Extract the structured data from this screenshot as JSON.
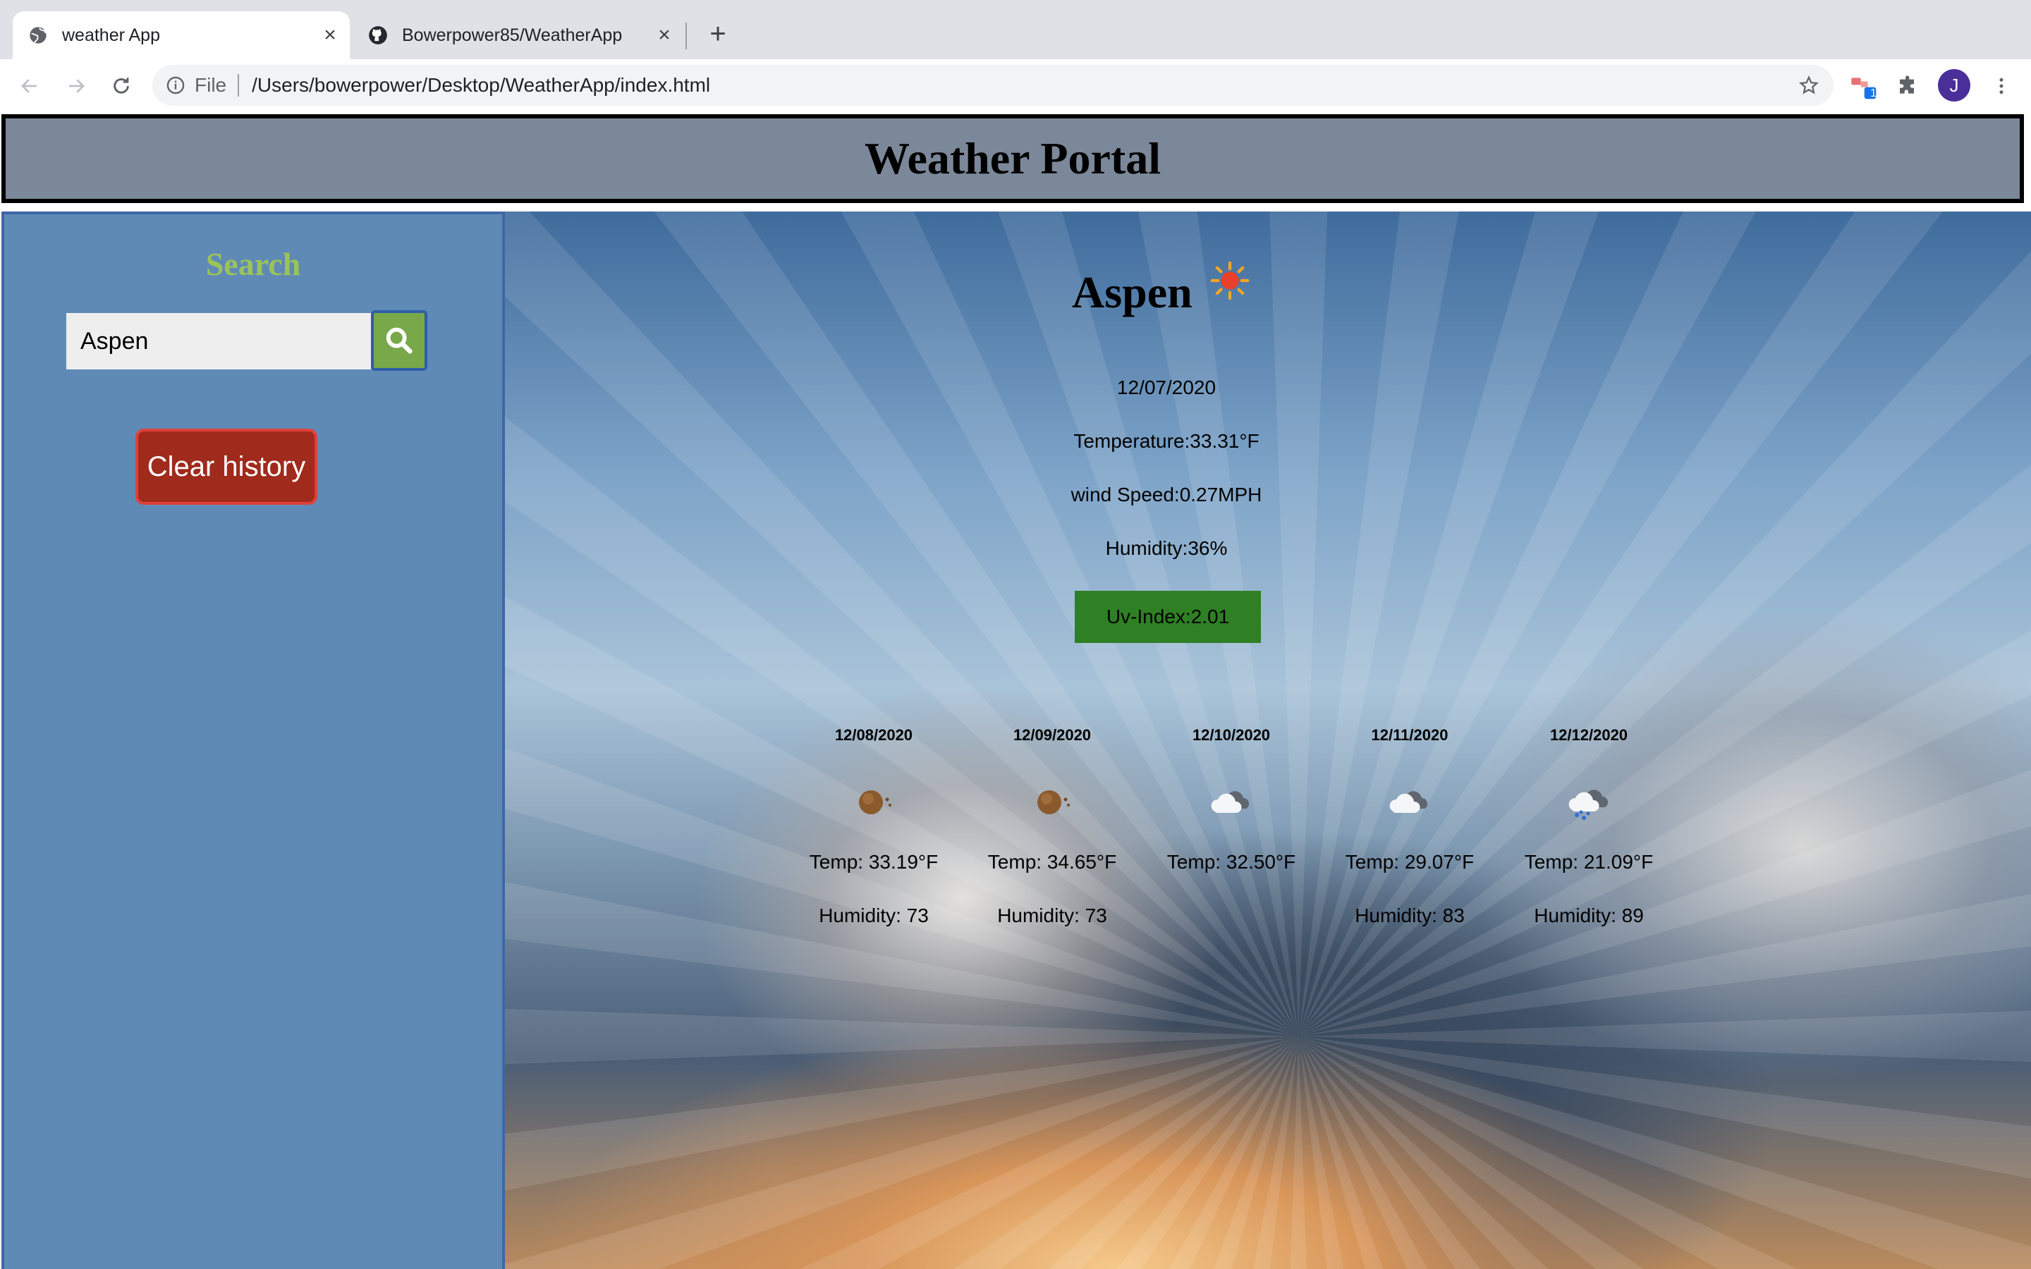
{
  "browser": {
    "tabs": [
      {
        "title": "weather App",
        "icon": "globe-icon",
        "active": true
      },
      {
        "title": "Bowerpower85/WeatherApp",
        "icon": "github-icon",
        "active": false
      }
    ],
    "url_scheme": "File",
    "url": "/Users/bowerpower/Desktop/WeatherApp/index.html",
    "profile_initial": "J",
    "extension_badge": "1"
  },
  "page": {
    "title": "Weather Portal",
    "sidebar": {
      "heading": "Search",
      "search_value": "Aspen",
      "clear_label": "Clear history"
    },
    "current": {
      "city": "Aspen",
      "icon": "sunny-icon",
      "date": "12/07/2020",
      "temperature": "Temperature:33.31°F",
      "wind": "wind Speed:0.27MPH",
      "humidity": "Humidity:36%",
      "uv": "Uv-Index:2.01",
      "uv_color": "#2f7f24"
    },
    "forecast": [
      {
        "date": "12/08/2020",
        "icon": "haze-icon",
        "temp": "Temp: 33.19°F",
        "humidity": "Humidity: 73"
      },
      {
        "date": "12/09/2020",
        "icon": "haze-icon",
        "temp": "Temp: 34.65°F",
        "humidity": "Humidity: 73"
      },
      {
        "date": "12/10/2020",
        "icon": "cloudy-icon",
        "temp": "Temp: 32.50°F",
        "humidity": ""
      },
      {
        "date": "12/11/2020",
        "icon": "cloudy-icon",
        "temp": "Temp: 29.07°F",
        "humidity": "Humidity: 83"
      },
      {
        "date": "12/12/2020",
        "icon": "snow-icon",
        "temp": "Temp: 21.09°F",
        "humidity": "Humidity: 89"
      }
    ]
  }
}
